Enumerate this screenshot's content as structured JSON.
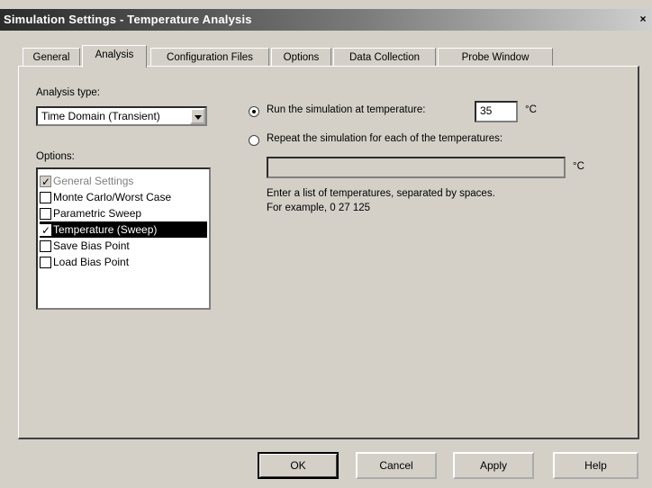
{
  "window": {
    "title": "Simulation Settings - Temperature Analysis",
    "close_glyph": "×"
  },
  "tabs": [
    {
      "label": "General",
      "active": false
    },
    {
      "label": "Analysis",
      "active": true
    },
    {
      "label": "Configuration Files",
      "active": false
    },
    {
      "label": "Options",
      "active": false
    },
    {
      "label": "Data Collection",
      "active": false
    },
    {
      "label": "Probe Window",
      "active": false
    }
  ],
  "analysis": {
    "analysis_type_label": "Analysis type:",
    "analysis_type_value": "Time Domain (Transient)",
    "options_label": "Options:",
    "options": [
      {
        "label": "General Settings",
        "checked": true,
        "disabled": true,
        "selected": false
      },
      {
        "label": "Monte Carlo/Worst Case",
        "checked": false,
        "disabled": false,
        "selected": false
      },
      {
        "label": "Parametric Sweep",
        "checked": false,
        "disabled": false,
        "selected": false
      },
      {
        "label": "Temperature (Sweep)",
        "checked": true,
        "disabled": false,
        "selected": true
      },
      {
        "label": "Save Bias Point",
        "checked": false,
        "disabled": false,
        "selected": false
      },
      {
        "label": "Load Bias Point",
        "checked": false,
        "disabled": false,
        "selected": false
      }
    ]
  },
  "temperature": {
    "run_at_label": "Run the simulation at temperature:",
    "run_at_value": "35",
    "unit": "°C",
    "repeat_label": "Repeat the simulation for each of the temperatures:",
    "repeat_value": "",
    "help_line1": "Enter a list of temperatures, separated by spaces.",
    "help_line2": "For example, 0  27  125",
    "selected_mode": "run_at"
  },
  "buttons": {
    "ok": "OK",
    "cancel": "Cancel",
    "apply": "Apply",
    "help": "Help"
  }
}
